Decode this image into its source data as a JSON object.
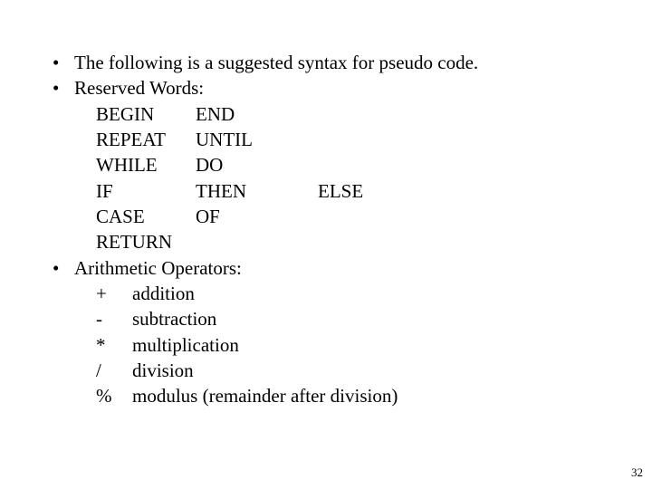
{
  "bullets": {
    "b1": "The following is a suggested syntax for pseudo code.",
    "b2": "Reserved Words:",
    "b3": "Arithmetic Operators:"
  },
  "reserved": {
    "r1a": "BEGIN",
    "r1b": "END",
    "r2a": "REPEAT",
    "r2b": "UNTIL",
    "r3a": "WHILE",
    "r3b": "DO",
    "r4a": "IF",
    "r4b": "THEN",
    "r4c": "ELSE",
    "r5a": "CASE",
    "r5b": "OF",
    "r6a": "RETURN"
  },
  "ops": {
    "o1s": "+",
    "o1d": "addition",
    "o2s": "-",
    "o2d": "subtraction",
    "o3s": "*",
    "o3d": "multiplication",
    "o4s": "/",
    "o4d": "division",
    "o5s": "%",
    "o5d": "modulus (remainder after division)"
  },
  "page": "32"
}
